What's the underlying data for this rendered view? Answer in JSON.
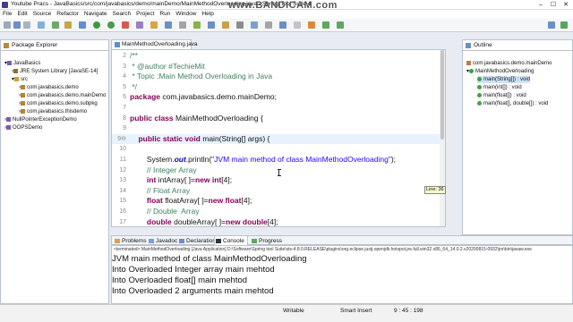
{
  "window": {
    "title": "Youtube Pracs - JavaBasics/src/com/javabasics/demo/mainDemo/MainMethodOverloading.java - Spring Tool Suite 4",
    "watermark": "www.BANDICAM.com"
  },
  "menu": [
    "File",
    "Edit",
    "Source",
    "Refactor",
    "Navigate",
    "Search",
    "Project",
    "Run",
    "Window",
    "Help"
  ],
  "package_explorer": {
    "tab_label": "Package Explorer",
    "items": [
      {
        "label": "JavaBasics",
        "indent": 0,
        "icon": "project-icon"
      },
      {
        "label": "JRE System Library [JavaSE-14]",
        "indent": 1,
        "icon": "library-icon"
      },
      {
        "label": "src",
        "indent": 1,
        "icon": "source-folder-icon"
      },
      {
        "label": "com.javabasics.demo",
        "indent": 2,
        "icon": "package-icon"
      },
      {
        "label": "com.javabasics.demo.mainDemo",
        "indent": 2,
        "icon": "package-icon"
      },
      {
        "label": "com.javabasics.demo.subpkg",
        "indent": 2,
        "icon": "package-icon"
      },
      {
        "label": "com.javabasics.thisdemo",
        "indent": 2,
        "icon": "package-icon"
      },
      {
        "label": "NullPointerExceptionDemo",
        "indent": 0,
        "icon": "project-icon"
      },
      {
        "label": "OOPSDemo",
        "indent": 0,
        "icon": "project-icon"
      }
    ]
  },
  "editor": {
    "tab_label": "MainMethodOverloading.java",
    "hover_tooltip": "Line: 36",
    "lines": [
      {
        "n": "2",
        "segs": [
          {
            "t": "/**",
            "c": "cm"
          }
        ]
      },
      {
        "n": "3",
        "segs": [
          {
            "t": " * @author #TechieMit",
            "c": "cm"
          }
        ]
      },
      {
        "n": "4",
        "segs": [
          {
            "t": " * Topic :Main Method Overloading in Java",
            "c": "cm"
          }
        ]
      },
      {
        "n": "5",
        "segs": [
          {
            "t": " */",
            "c": "cm"
          }
        ]
      },
      {
        "n": "6",
        "segs": [
          {
            "t": "package ",
            "c": "kw"
          },
          {
            "t": "com.javabasics.demo.mainDemo;",
            "c": ""
          }
        ]
      },
      {
        "n": "7",
        "segs": []
      },
      {
        "n": "8",
        "segs": [
          {
            "t": "public class ",
            "c": "kw"
          },
          {
            "t": "MainMethodOverloading {",
            "c": ""
          }
        ]
      },
      {
        "n": "9",
        "segs": []
      },
      {
        "n": "9⊖",
        "segs": [
          {
            "t": "    public static void ",
            "c": "kw"
          },
          {
            "t": "main(String[] args) {",
            "c": ""
          }
        ],
        "hl": true
      },
      {
        "n": "10",
        "segs": []
      },
      {
        "n": "11",
        "segs": [
          {
            "t": "        System.",
            "c": ""
          },
          {
            "t": "out",
            "c": "it kwb"
          },
          {
            "t": ".println(",
            "c": ""
          },
          {
            "t": "\"JVM main method of class MainMethodOverloading\"",
            "c": "st"
          },
          {
            "t": ");",
            "c": ""
          }
        ]
      },
      {
        "n": "12",
        "segs": [
          {
            "t": "        // Integer Array",
            "c": "cm"
          }
        ]
      },
      {
        "n": "13",
        "segs": [
          {
            "t": "        ",
            "c": ""
          },
          {
            "t": "int ",
            "c": "kw"
          },
          {
            "t": "intArray[ ]=",
            "c": ""
          },
          {
            "t": "new int",
            "c": "kw"
          },
          {
            "t": "[4];",
            "c": ""
          }
        ]
      },
      {
        "n": "14",
        "segs": [
          {
            "t": "        // Float Array",
            "c": "cm"
          }
        ]
      },
      {
        "n": "15",
        "segs": [
          {
            "t": "        ",
            "c": ""
          },
          {
            "t": "float ",
            "c": "kw"
          },
          {
            "t": "floatArray[ ]=",
            "c": ""
          },
          {
            "t": "new float",
            "c": "kw"
          },
          {
            "t": "[4];",
            "c": ""
          }
        ]
      },
      {
        "n": "16",
        "segs": [
          {
            "t": "        // Double  Array",
            "c": "cm"
          }
        ]
      },
      {
        "n": "17",
        "segs": [
          {
            "t": "        ",
            "c": ""
          },
          {
            "t": "double ",
            "c": "kw"
          },
          {
            "t": "doubleArray[ ]=",
            "c": ""
          },
          {
            "t": "new double",
            "c": "kw"
          },
          {
            "t": "[4];",
            "c": ""
          }
        ]
      }
    ]
  },
  "outline": {
    "tab_label": "Outline",
    "items": [
      {
        "label": "com.javabasics.demo.mainDemo",
        "indent": 0
      },
      {
        "label": "MainMethodOverloading",
        "indent": 0
      },
      {
        "label": "main(String[]) : void",
        "indent": 1,
        "selected": true
      },
      {
        "label": "main(int[]) : void",
        "indent": 1
      },
      {
        "label": "main(float[]) : void",
        "indent": 1
      },
      {
        "label": "main(float[], double[]) : void",
        "indent": 1
      }
    ]
  },
  "bottom_tabs": [
    "Problems",
    "Javadoc",
    "Declaration",
    "Console",
    "Progress"
  ],
  "console": {
    "terminated_line": "<terminated> MainMethodOverloading [Java Application] D:\\Software\\Spring tool Suite\\sts-4.8.0.RELEASE\\plugins\\org.eclipse.justj.openjdk.hotspot.jre.full.win32.x86_64_14.0.2.v20200815-0932\\jre\\bin\\javaw.exe",
    "output": [
      "JVM main method of class MainMethodOverloading",
      "Into Overloaded  Integer array main mehtod",
      "Into Overloaded  float[] main mehtod",
      "Into Overloaded  2 arguments main mehtod"
    ]
  },
  "status": {
    "writable": "Writable",
    "insert": "Smart Insert",
    "position": "9 : 45 : 198"
  }
}
